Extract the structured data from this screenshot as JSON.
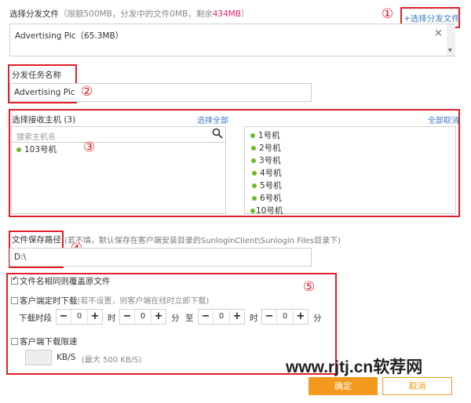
{
  "file_section": {
    "label": "选择分发文件",
    "quota_prefix": "（限额500MB，分发中的文件0MB，剩余",
    "quota_remaining": "434MB",
    "quota_suffix": "）",
    "add_file_link": "+选择分发文件",
    "file_entry": "Advertising Pic（65.3MB）"
  },
  "task_section": {
    "label": "分发任务名称",
    "task_name_value": "Advertising Pic"
  },
  "hosts_section": {
    "label": "选择接收主机 (3)",
    "select_all": "选择全部",
    "cancel_all": "全部取消",
    "search_placeholder": "搜索主机名",
    "available_hosts": [
      "103号机"
    ],
    "selected_hosts": [
      "1号机",
      "2号机",
      "3号机",
      "4号机",
      "5号机",
      "6号机",
      "10号机"
    ]
  },
  "path_section": {
    "label": "文件保存路径",
    "hint": "(若不填，默认保存在客户端安装目录的SunloginClient\\Sunlogin Files目录下)",
    "path_value": "D:\\"
  },
  "options_section": {
    "overwrite_label": "文件名相同则覆盖原文件",
    "overwrite_checked": true,
    "scheduled_label": "客户端定时下载",
    "scheduled_hint": "(若不设置，则客户端在线时立即下载)",
    "scheduled_checked": false,
    "period_label": "下载时段",
    "hour_unit": "时",
    "minute_unit": "分",
    "to_label": "至",
    "start_hour": "0",
    "start_minute": "0",
    "end_hour": "0",
    "end_minute": "0",
    "speed_label": "客户端下载限速",
    "speed_checked": false,
    "speed_unit": "KB/S",
    "speed_hint": "(最大 500 KB/S)"
  },
  "annotations": [
    "①",
    "②",
    "③",
    "④",
    "⑤"
  ],
  "buttons": {
    "confirm": "确定",
    "cancel": "取消"
  },
  "watermark": "www.rjtj.cn软荐网",
  "colors": {
    "accent_orange": "#f39a1e",
    "annotation_red": "#e0202a",
    "link_blue": "#3f7fc6",
    "online_green": "#6dbb2a",
    "quota_pink": "#e3276a"
  }
}
